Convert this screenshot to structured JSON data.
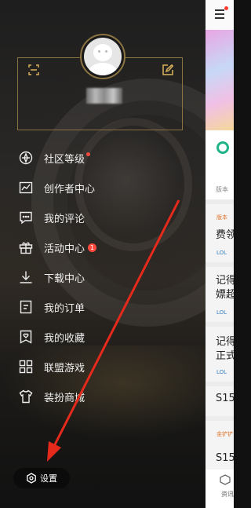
{
  "drawer": {
    "menu": [
      {
        "id": "community-level",
        "label": "社区等级",
        "icon": "diamond-star-icon",
        "indicator": "dot"
      },
      {
        "id": "creator-center",
        "label": "创作者中心",
        "icon": "chart-line-icon"
      },
      {
        "id": "my-comments",
        "label": "我的评论",
        "icon": "comment-icon"
      },
      {
        "id": "activity-center",
        "label": "活动中心",
        "icon": "gift-icon",
        "badge": "1"
      },
      {
        "id": "download-center",
        "label": "下载中心",
        "icon": "download-icon"
      },
      {
        "id": "my-orders",
        "label": "我的订单",
        "icon": "order-icon"
      },
      {
        "id": "my-favorites",
        "label": "我的收藏",
        "icon": "bookmark-heart-icon"
      },
      {
        "id": "league-games",
        "label": "联盟游戏",
        "icon": "grid-icon"
      },
      {
        "id": "dress-mall",
        "label": "装扮商城",
        "icon": "tshirt-icon"
      }
    ],
    "settings_label": "设置"
  },
  "right_page": {
    "items": [
      {
        "tag": "",
        "title": "费领",
        "meta": "LOL"
      },
      {
        "tag": "",
        "title": "记得",
        "subtitle": "嫖超",
        "meta": "LOL"
      },
      {
        "tag": "",
        "title": "记得",
        "subtitle": "正式",
        "meta": "LOL"
      },
      {
        "tag": "",
        "title": "S15",
        "meta": ""
      },
      {
        "tag": "金铲铲",
        "title": "S15",
        "meta": ""
      }
    ],
    "card_text": "版本",
    "tag_text": "版本",
    "nav_label": "资讯"
  },
  "colors": {
    "accent_gold": "#8b7442",
    "badge_red": "#ff4a3d",
    "arrow_red": "#e52a1c"
  }
}
